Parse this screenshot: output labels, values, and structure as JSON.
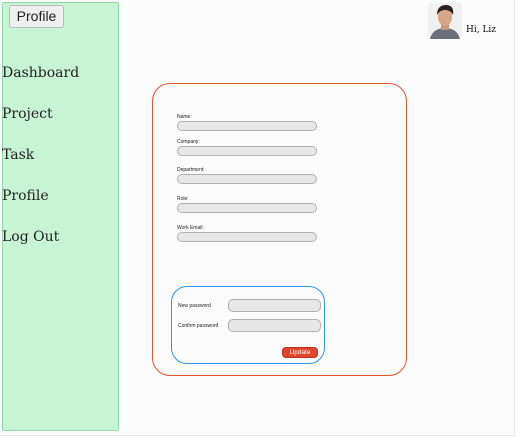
{
  "header": {
    "page_title": "Profile",
    "greeting": "Hi, Liz"
  },
  "sidebar": {
    "items": [
      {
        "label": "Dashboard"
      },
      {
        "label": "Project"
      },
      {
        "label": "Task"
      },
      {
        "label": "Profile"
      },
      {
        "label": "Log Out"
      }
    ]
  },
  "profile_form": {
    "fields": [
      {
        "label": "Name:",
        "value": ""
      },
      {
        "label": "Company:",
        "value": ""
      },
      {
        "label": "Department:",
        "value": ""
      },
      {
        "label": "Role:",
        "value": ""
      },
      {
        "label": "Work Email:",
        "value": ""
      }
    ]
  },
  "password_form": {
    "new_password_label": "New password",
    "confirm_password_label": "Confirm password",
    "update_label": "Update"
  },
  "colors": {
    "sidebar_bg": "#c8f4d6",
    "profile_card_border": "#e0552c",
    "password_card_border": "#2a99e6",
    "update_button": "#e2452b"
  }
}
